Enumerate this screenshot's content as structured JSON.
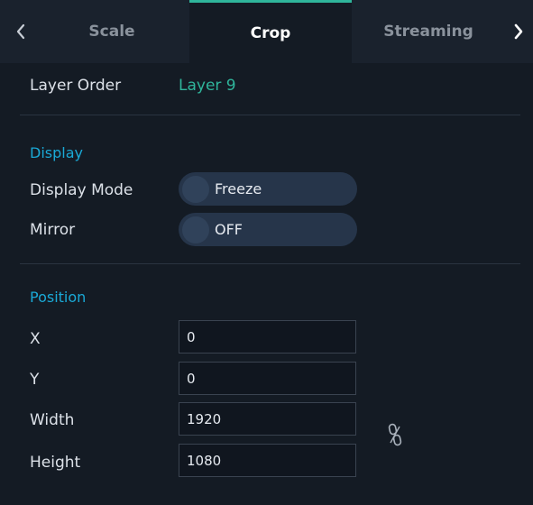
{
  "tabs": [
    {
      "label": "Scale",
      "active": false
    },
    {
      "label": "Crop",
      "active": true
    },
    {
      "label": "Streaming",
      "active": false
    }
  ],
  "layer_order": {
    "label": "Layer Order",
    "value": "Layer 9"
  },
  "display": {
    "section_title": "Display",
    "display_mode": {
      "label": "Display Mode",
      "value": "Freeze"
    },
    "mirror": {
      "label": "Mirror",
      "value": "OFF"
    }
  },
  "position": {
    "section_title": "Position",
    "x": {
      "label": "X",
      "value": "0"
    },
    "y": {
      "label": "Y",
      "value": "0"
    },
    "width": {
      "label": "Width",
      "value": "1920"
    },
    "height": {
      "label": "Height",
      "value": "1080"
    }
  },
  "icons": {
    "prev": "chevron-left-icon",
    "next": "chevron-right-icon",
    "aspect_lock": "unlink-icon"
  },
  "colors": {
    "accent": "#2fb59b",
    "section": "#1aa9d6",
    "background": "#141b24",
    "tab_bar": "#1a222d",
    "toggle": "#26354a"
  }
}
